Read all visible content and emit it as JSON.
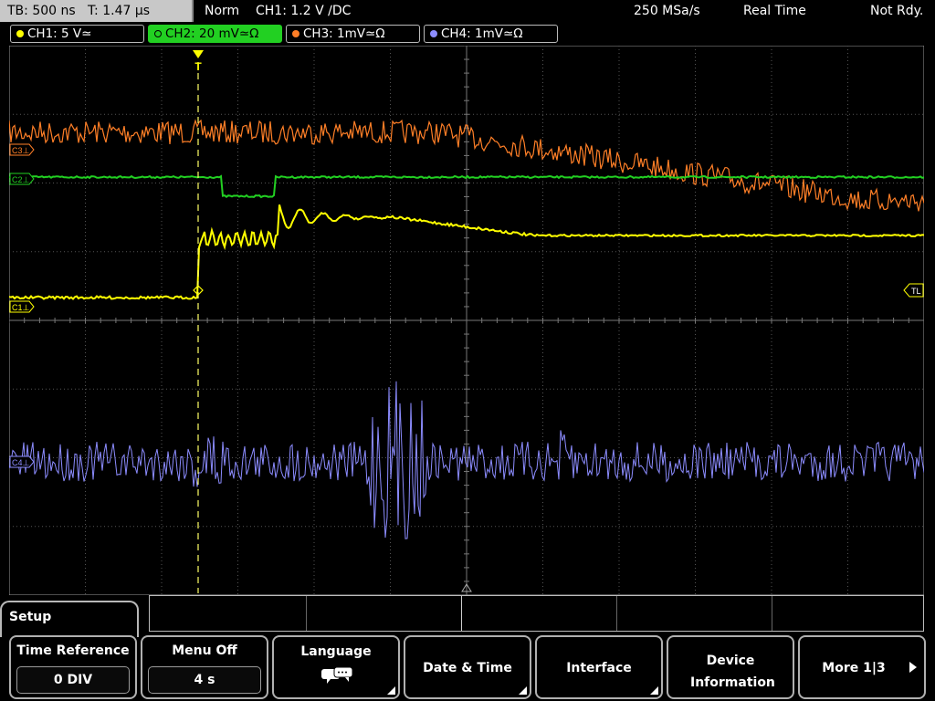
{
  "status_bar": {
    "timebase": "TB: 500 ns",
    "trigger_time": "T: 1.47 µs",
    "trigger_mode": "Norm",
    "trigger_source": "CH1: 1.2 V ∕DC",
    "sample_rate": "250 MSa/s",
    "acq_mode": "Real Time",
    "status": "Not Rdy."
  },
  "channels": [
    {
      "label": "CH1: 5 V≃",
      "color": "#ffff00",
      "active": false
    },
    {
      "label": "CH2: 20 mV≃Ω",
      "color": "#22d022",
      "active": true
    },
    {
      "label": "CH3: 1mV≃Ω",
      "color": "#ff7f27",
      "active": false
    },
    {
      "label": "CH4: 1mV≃Ω",
      "color": "#8c8cff",
      "active": false
    }
  ],
  "markers": {
    "c3": "C3⊥",
    "c2": "C2⊥",
    "c1": "C1⊥",
    "c4": "C4⊥",
    "trigger_level": "TL",
    "trigger_position": "T"
  },
  "menu": {
    "title": "Setup",
    "softkeys": [
      {
        "title": "Time Reference",
        "value": "0 DIV"
      },
      {
        "title": "Menu Off",
        "value": "4 s"
      },
      {
        "title": "Language",
        "icon": "speech-bubbles-icon"
      },
      {
        "title": "Date & Time"
      },
      {
        "title": "Interface"
      },
      {
        "title": "Device Information"
      },
      {
        "title": "More 1|3"
      }
    ]
  },
  "colors": {
    "ch1": "#ffff00",
    "ch2": "#22d022",
    "ch3": "#ff7f27",
    "ch4": "#8c8cff",
    "grid": "#555555"
  }
}
